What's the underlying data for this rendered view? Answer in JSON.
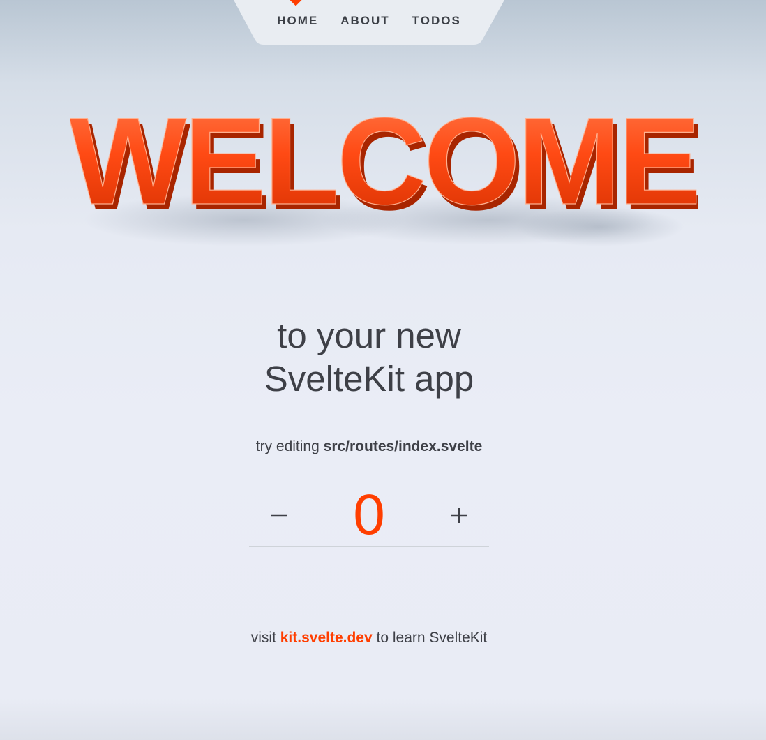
{
  "nav": {
    "items": [
      {
        "label": "HOME"
      },
      {
        "label": "ABOUT"
      },
      {
        "label": "TODOS"
      }
    ],
    "active_index": 0
  },
  "hero": {
    "text": "WELCOME",
    "color": "#ff3e00"
  },
  "headline": {
    "line1": "to your new",
    "line2": "SvelteKit app"
  },
  "hint": {
    "prefix": "try editing",
    "path": "src/routes/index.svelte"
  },
  "counter": {
    "value": "0",
    "decrement_icon": "minus-icon",
    "increment_icon": "plus-icon"
  },
  "footer": {
    "prefix": "visit",
    "link_text": "kit.svelte.dev",
    "suffix": "to learn SvelteKit"
  },
  "colors": {
    "accent": "#ff3e00",
    "text": "#40434a",
    "nav_bg": "#e9edf2"
  }
}
